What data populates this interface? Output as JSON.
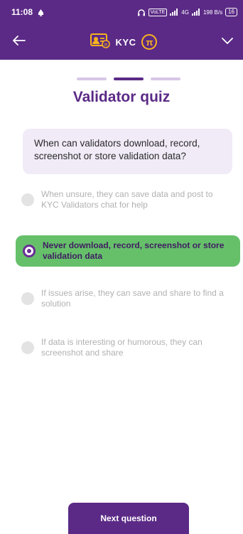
{
  "status_bar": {
    "time": "11:08",
    "volte": "VoLTE",
    "network": "4G",
    "speed": "198 B/s",
    "battery": "16"
  },
  "app_bar": {
    "title": "KYC",
    "coin_symbol": "π"
  },
  "quiz": {
    "progress": {
      "total": 3,
      "current": 2
    },
    "title": "Validator quiz",
    "question": "When can validators download, record, screenshot or store validation data?",
    "options": [
      {
        "label": "When unsure, they can save data and post to KYC Validators chat for help",
        "selected": false
      },
      {
        "label": "Never download, record, screenshot or store validation data",
        "selected": true
      },
      {
        "label": "If issues arise, they can save and share to find a solution",
        "selected": false
      },
      {
        "label": "If data is interesting or humorous, they can screenshot and share",
        "selected": false
      }
    ],
    "next_button": "Next question"
  },
  "colors": {
    "brand_purple": "#5b2a86",
    "selected_green": "#66c06a",
    "pi_gold": "#f7b31e"
  }
}
